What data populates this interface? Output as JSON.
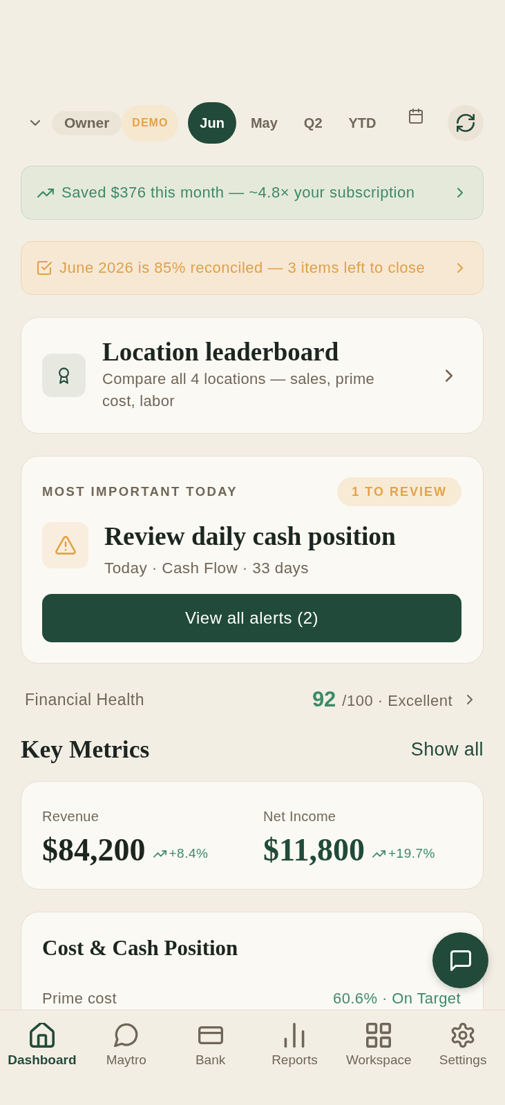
{
  "role_switcher": {
    "label": "Owner",
    "badge": "DEMO"
  },
  "periods": [
    {
      "label": "Jun",
      "selected": true
    },
    {
      "label": "May",
      "selected": false
    },
    {
      "label": "Q2",
      "selected": false
    },
    {
      "label": "YTD",
      "selected": false
    }
  ],
  "banners": [
    {
      "kind": "success",
      "text": "Saved $376 this month — ~4.8× your subscription"
    },
    {
      "kind": "warning",
      "text": "June 2026 is 85% reconciled — 3 items left to close"
    }
  ],
  "leaderboard_card": {
    "title": "Location leaderboard",
    "subtitle": "Compare all 4 locations — sales, prime cost, labor"
  },
  "priority_card": {
    "label": "MOST IMPORTANT TODAY",
    "badge": "1 TO REVIEW",
    "alert": {
      "title": "Review daily cash position",
      "meta": "Today · Cash Flow · 33 days"
    },
    "button": "View all alerts (2)"
  },
  "financial_health": {
    "label": "Financial Health",
    "score": "92",
    "scale": "/100 · Excellent"
  },
  "key_metrics": {
    "title": "Key Metrics",
    "action": "Show all",
    "metrics": [
      {
        "label": "Revenue",
        "value": "$84,200",
        "change": "+8.4%",
        "color": "#1c2620"
      },
      {
        "label": "Net Income",
        "value": "$11,800",
        "change": "+19.7%",
        "color": "#214a3a"
      }
    ]
  },
  "cost_cash": {
    "title": "Cost & Cash Position",
    "rows": [
      {
        "label": "Prime cost",
        "value": "60.6% · On Target"
      }
    ]
  },
  "bottom_nav": [
    {
      "label": "Dashboard",
      "selected": true
    },
    {
      "label": "Maytro",
      "selected": false
    },
    {
      "label": "Bank",
      "selected": false
    },
    {
      "label": "Reports",
      "selected": false
    },
    {
      "label": "Workspace",
      "selected": false
    },
    {
      "label": "Settings",
      "selected": false
    }
  ]
}
